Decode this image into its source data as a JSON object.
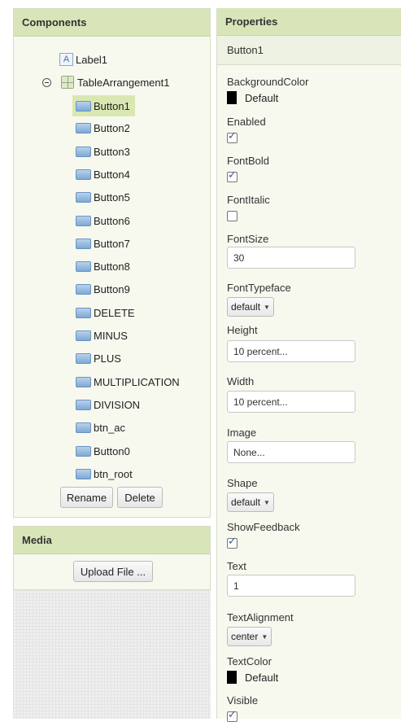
{
  "components": {
    "header": "Components",
    "label_item": "Label1",
    "table_item": "TableArrangement1",
    "buttons": [
      "Button1",
      "Button2",
      "Button3",
      "Button4",
      "Button5",
      "Button6",
      "Button7",
      "Button8",
      "Button9",
      "DELETE",
      "MINUS",
      "PLUS",
      "MULTIPLICATION",
      "DIVISION",
      "btn_ac",
      "Button0",
      "btn_root"
    ],
    "rename_label": "Rename",
    "delete_label": "Delete"
  },
  "media": {
    "header": "Media",
    "upload_label": "Upload File ..."
  },
  "properties": {
    "header": "Properties",
    "selected": "Button1",
    "background_color": {
      "label": "BackgroundColor",
      "value": "Default",
      "swatch": "#000000"
    },
    "enabled": {
      "label": "Enabled",
      "checked": true
    },
    "font_bold": {
      "label": "FontBold",
      "checked": true
    },
    "font_italic": {
      "label": "FontItalic",
      "checked": false
    },
    "font_size": {
      "label": "FontSize",
      "value": "30"
    },
    "font_typeface": {
      "label": "FontTypeface",
      "value": "default"
    },
    "height": {
      "label": "Height",
      "value": "10 percent..."
    },
    "width": {
      "label": "Width",
      "value": "10 percent..."
    },
    "image": {
      "label": "Image",
      "value": "None..."
    },
    "shape": {
      "label": "Shape",
      "value": "default"
    },
    "show_feedback": {
      "label": "ShowFeedback",
      "checked": true
    },
    "text": {
      "label": "Text",
      "value": "1"
    },
    "text_alignment": {
      "label": "TextAlignment",
      "value": "center"
    },
    "text_color": {
      "label": "TextColor",
      "value": "Default",
      "swatch": "#000000"
    },
    "visible": {
      "label": "Visible",
      "checked": true
    }
  }
}
